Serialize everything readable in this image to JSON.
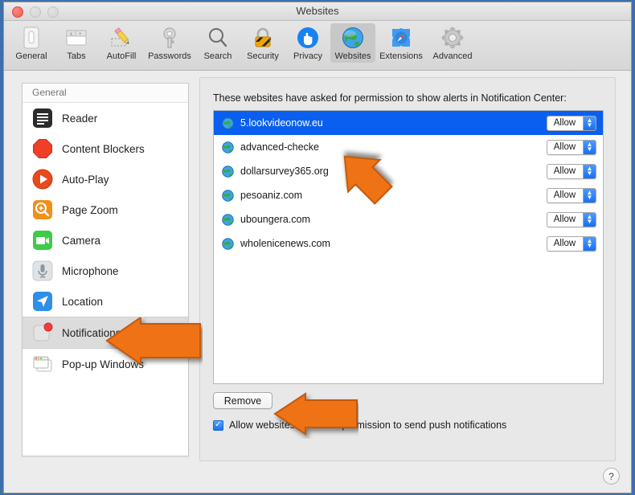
{
  "window": {
    "title": "Websites",
    "traffic_lights": [
      "close",
      "minimize",
      "zoom"
    ]
  },
  "toolbar": {
    "items": [
      {
        "label": "General",
        "icon": "general-icon",
        "selected": false
      },
      {
        "label": "Tabs",
        "icon": "tabs-icon",
        "selected": false
      },
      {
        "label": "AutoFill",
        "icon": "autofill-icon",
        "selected": false
      },
      {
        "label": "Passwords",
        "icon": "passwords-icon",
        "selected": false
      },
      {
        "label": "Search",
        "icon": "search-icon",
        "selected": false
      },
      {
        "label": "Security",
        "icon": "security-icon",
        "selected": false
      },
      {
        "label": "Privacy",
        "icon": "privacy-icon",
        "selected": false
      },
      {
        "label": "Websites",
        "icon": "websites-icon",
        "selected": true
      },
      {
        "label": "Extensions",
        "icon": "extensions-icon",
        "selected": false
      },
      {
        "label": "Advanced",
        "icon": "advanced-icon",
        "selected": false
      }
    ]
  },
  "sidebar": {
    "header": "General",
    "items": [
      {
        "label": "Reader",
        "icon": "reader-icon",
        "selected": false
      },
      {
        "label": "Content Blockers",
        "icon": "content-blockers-icon",
        "selected": false
      },
      {
        "label": "Auto-Play",
        "icon": "auto-play-icon",
        "selected": false
      },
      {
        "label": "Page Zoom",
        "icon": "page-zoom-icon",
        "selected": false
      },
      {
        "label": "Camera",
        "icon": "camera-icon",
        "selected": false
      },
      {
        "label": "Microphone",
        "icon": "microphone-icon",
        "selected": false
      },
      {
        "label": "Location",
        "icon": "location-icon",
        "selected": false
      },
      {
        "label": "Notifications",
        "icon": "notifications-icon",
        "selected": true
      },
      {
        "label": "Pop-up Windows",
        "icon": "popup-windows-icon",
        "selected": false
      }
    ]
  },
  "main": {
    "description": "These websites have asked for permission to show alerts in Notification Center:",
    "websites": [
      {
        "name": "5.lookvideonow.eu",
        "permission": "Allow",
        "selected": true
      },
      {
        "name": "advanced-checke",
        "permission": "Allow",
        "selected": false
      },
      {
        "name": "dollarsurvey365.org",
        "permission": "Allow",
        "selected": false
      },
      {
        "name": "pesoaniz.com",
        "permission": "Allow",
        "selected": false
      },
      {
        "name": "uboungera.com",
        "permission": "Allow",
        "selected": false
      },
      {
        "name": "wholenicenews.com",
        "permission": "Allow",
        "selected": false
      }
    ],
    "remove_button": "Remove",
    "checkbox": {
      "label": "Allow websites to ask for permission to send push notifications",
      "checked": true,
      "mark": "✓"
    },
    "help_button": "?"
  },
  "colors": {
    "selection_blue": "#0a5ff1",
    "annotation_orange": "#ef7215",
    "window_border": "#3f6fa8"
  },
  "annotations": [
    {
      "name": "arrow-pointing-to-selected-website"
    },
    {
      "name": "arrow-pointing-to-notifications"
    },
    {
      "name": "arrow-pointing-to-remove-button"
    }
  ]
}
